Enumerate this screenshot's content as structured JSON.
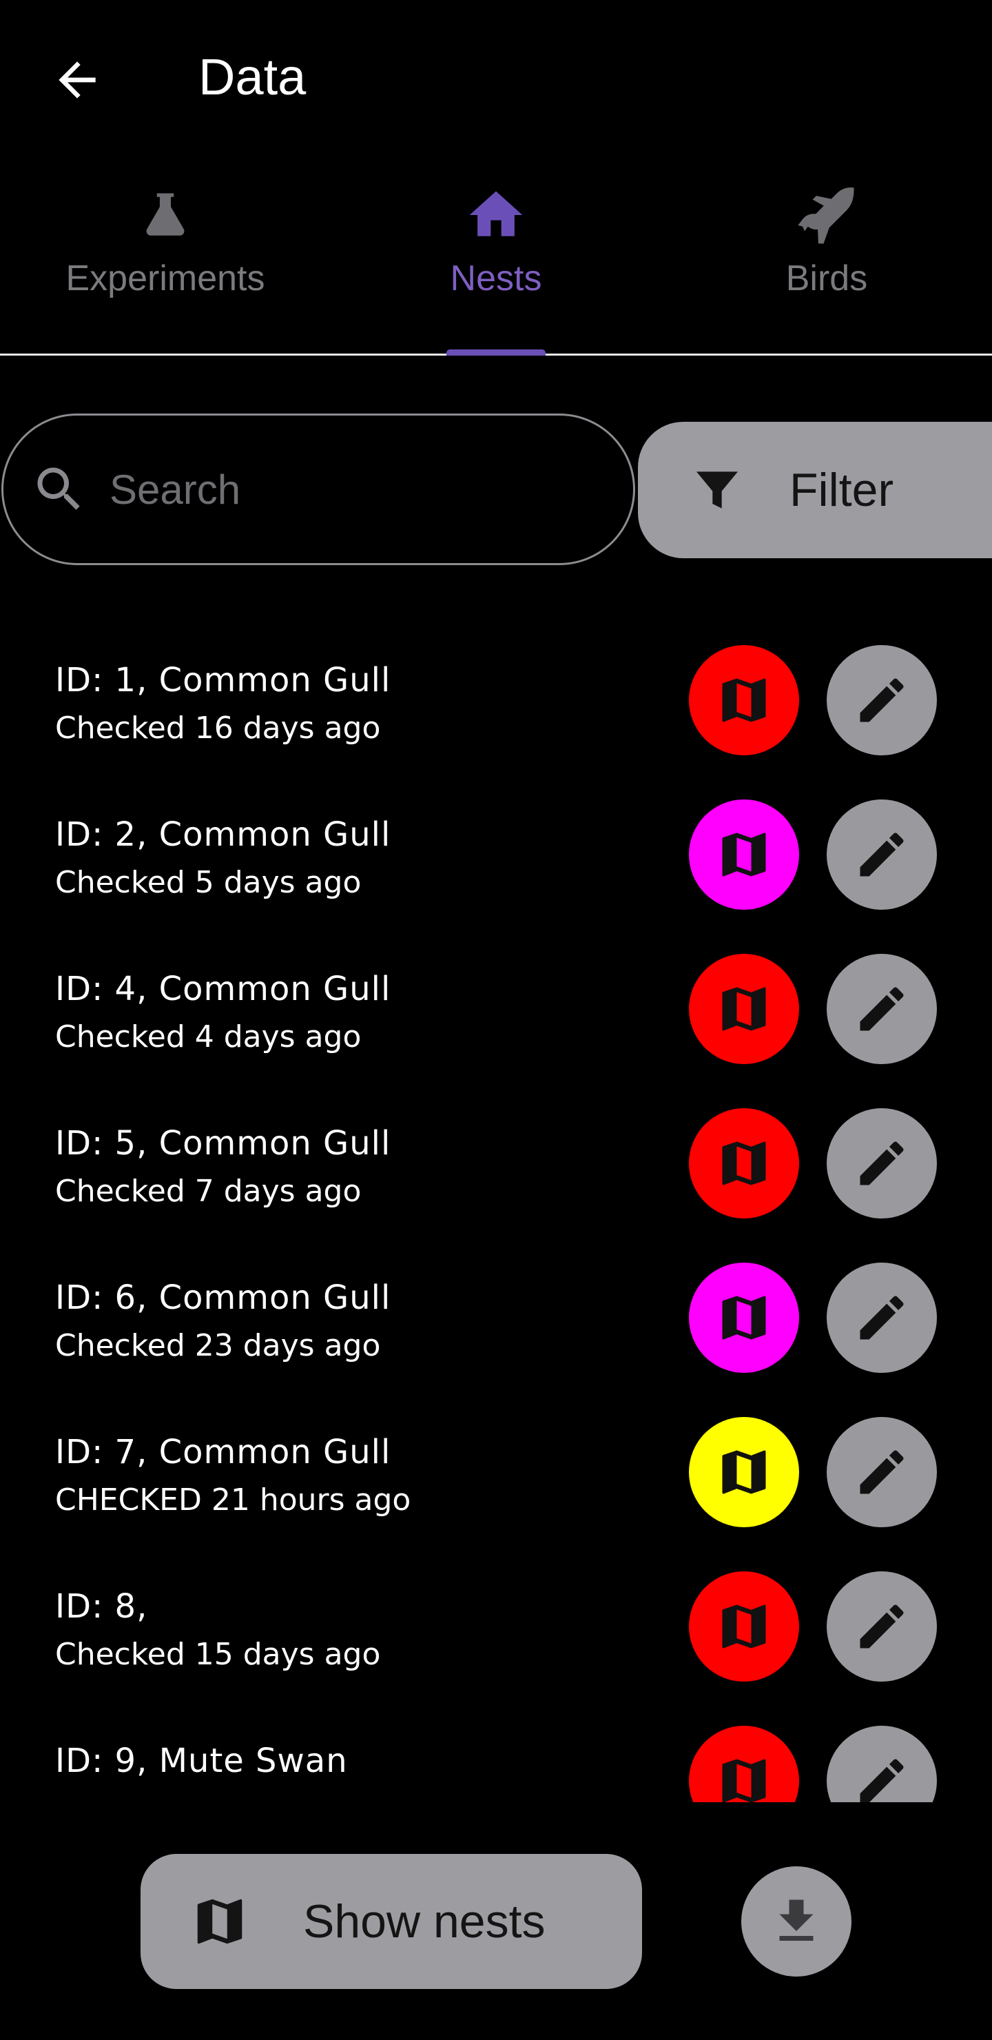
{
  "header": {
    "title": "Data",
    "back_icon": "arrow-left-icon"
  },
  "tabs": [
    {
      "label": "Experiments",
      "icon": "flask-icon",
      "active": false
    },
    {
      "label": "Nests",
      "icon": "home-icon",
      "active": true
    },
    {
      "label": "Birds",
      "icon": "bird-icon",
      "active": false
    }
  ],
  "search": {
    "placeholder": "Search",
    "value": ""
  },
  "filter": {
    "label": "Filter",
    "icon": "filter-icon"
  },
  "nests": [
    {
      "title": "ID: 1, Common Gull",
      "subtitle": "Checked 16 days ago",
      "map_color": "#ff0000"
    },
    {
      "title": "ID: 2, Common Gull",
      "subtitle": "Checked 5 days ago",
      "map_color": "#ff00ff"
    },
    {
      "title": "ID: 4, Common Gull",
      "subtitle": "Checked 4 days ago",
      "map_color": "#ff0000"
    },
    {
      "title": "ID: 5, Common Gull",
      "subtitle": "Checked 7 days ago",
      "map_color": "#ff0000"
    },
    {
      "title": "ID: 6, Common Gull",
      "subtitle": "Checked 23 days ago",
      "map_color": "#ff00ff"
    },
    {
      "title": "ID: 7, Common Gull",
      "subtitle": "CHECKED 21 hours ago",
      "map_color": "#ffff00"
    },
    {
      "title": "ID: 8,",
      "subtitle": "Checked 15 days ago",
      "map_color": "#ff0000"
    },
    {
      "title": "ID: 9, Mute Swan",
      "subtitle": "",
      "map_color": "#ff0000"
    }
  ],
  "actions": {
    "show_nests_label": "Show nests",
    "show_nests_icon": "map-icon",
    "download_icon": "download-icon"
  },
  "colors": {
    "accent": "#6b4fb8",
    "accent_text": "#7e5fc0",
    "button_gray": "#9c9ca1",
    "status_red": "#ff0000",
    "status_magenta": "#ff00ff",
    "status_yellow": "#ffff00"
  }
}
